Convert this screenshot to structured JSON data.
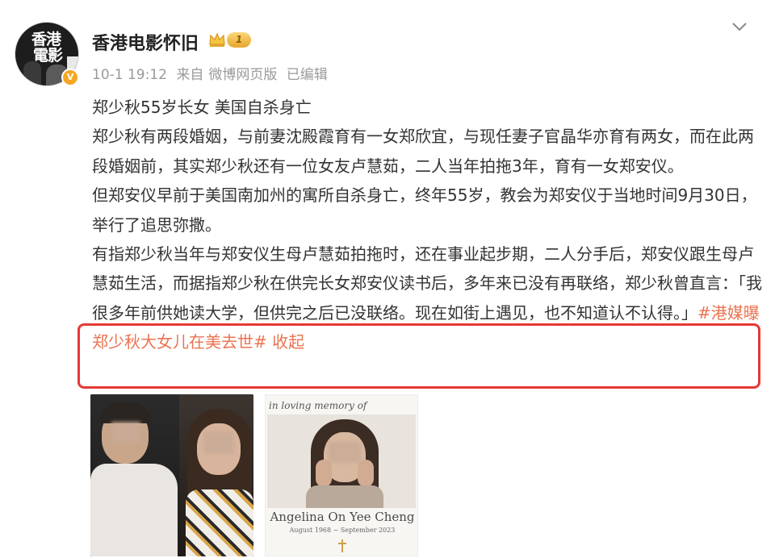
{
  "post": {
    "username": "香港电影怀旧",
    "level": "1",
    "meta": {
      "date": "10-1 19:12",
      "source_prefix": "来自",
      "source": "微博网页版",
      "edited": "已编辑"
    },
    "content": {
      "title": "郑少秋55岁长女 美国自杀身亡",
      "para1": "郑少秋有两段婚姻，与前妻沈殿霞育有一女郑欣宜，与现任妻子官晶华亦育有两女，而在此两段婚姻前，其实郑少秋还有一位女友卢慧茹，二人当年拍拖3年，育有一女郑安仪。",
      "para2": "但郑安仪早前于美国南加州的寓所自杀身亡，终年55岁，教会为郑安仪于当地时间9月30日，举行了追思弥撒。",
      "para3": "有指郑少秋当年与郑安仪生母卢慧茹拍拖时，还在事业起步期，二人分手后，郑安仪跟生母卢慧茹生活，而据指郑少秋在供完长女郑安仪读书后，多年来已没有再联络，郑少秋曾直言：「我很多年前供她读大学，但供完之后已没联络。现在如街上遇见，也不知道认不认得。」",
      "topic": "#港媒曝郑少秋大女儿在美去世#",
      "collapse": "收起"
    },
    "images": {
      "memorial": {
        "header": "in loving memory of",
        "name": "Angelina On Yee Cheng",
        "dates": "August 1968 ~ September 2023"
      }
    },
    "avatar": {
      "line1": "香港",
      "line2": "電影"
    }
  },
  "colors": {
    "link": "#eb7350",
    "highlight_border": "#e53935",
    "meta_text": "#9a9a9a",
    "body_text": "#333333"
  },
  "icons": {
    "crown": "crown-icon",
    "menu": "chevron-down-icon",
    "verified": "verified-badge-icon",
    "cross": "cross-icon"
  }
}
